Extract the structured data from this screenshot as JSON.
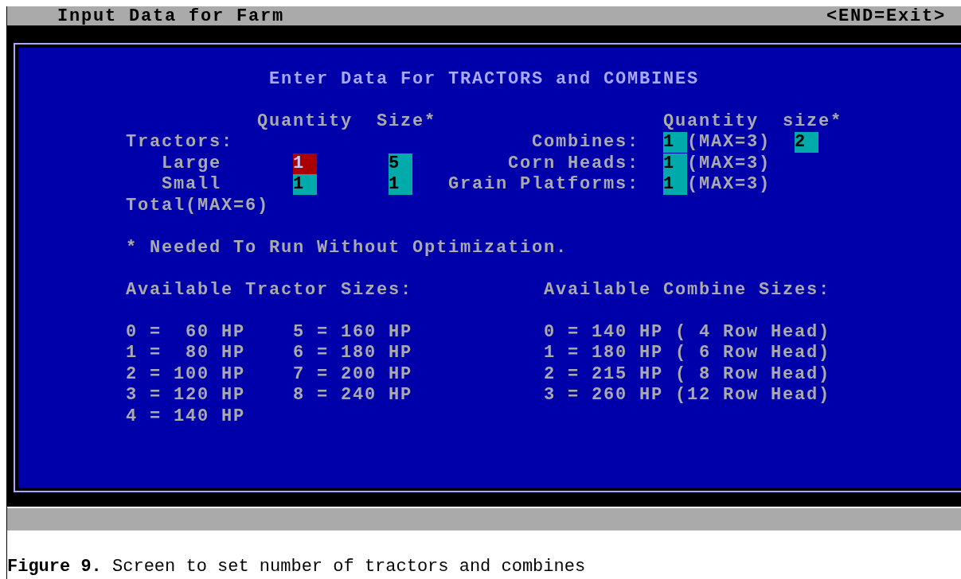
{
  "title_bar": {
    "title": "Input Data for Farm",
    "hint": "<END=Exit>"
  },
  "form": {
    "heading": "Enter Data For TRACTORS and COMBINES",
    "tractor_headers": [
      "Quantity",
      "Size*"
    ],
    "tractors_label": "Tractors:",
    "tractor_rows": [
      {
        "label": "Large",
        "quantity": {
          "value": "1",
          "selected": true
        },
        "size": {
          "value": "5",
          "selected": false
        }
      },
      {
        "label": "Small",
        "quantity": {
          "value": "1",
          "selected": false
        },
        "size": {
          "value": "1",
          "selected": false
        }
      }
    ],
    "total_label": "Total(MAX=6)",
    "combine_headers": [
      "Quantity",
      "size*"
    ],
    "combine_rows": [
      {
        "label": "Combines:",
        "quantity": {
          "value": "1",
          "selected": false
        },
        "max": "(MAX=3)",
        "size": {
          "value": "2",
          "selected": false
        }
      },
      {
        "label": "Corn Heads:",
        "quantity": {
          "value": "1",
          "selected": false
        },
        "max": "(MAX=3)"
      },
      {
        "label": "Grain Platforms:",
        "quantity": {
          "value": "1",
          "selected": false
        },
        "max": "(MAX=3)"
      }
    ],
    "note": "* Needed To Run Without Optimization.",
    "tractor_sizes_title": "Available Tractor Sizes:",
    "tractor_sizes": [
      "0 =  60 HP",
      "1 =  80 HP",
      "2 = 100 HP",
      "3 = 120 HP",
      "4 = 140 HP",
      "5 = 160 HP",
      "6 = 180 HP",
      "7 = 200 HP",
      "8 = 240 HP"
    ],
    "combine_sizes_title": "Available Combine Sizes:",
    "combine_sizes": [
      "0 = 140 HP ( 4 Row Head)",
      "1 = 180 HP ( 6 Row Head)",
      "2 = 215 HP ( 8 Row Head)",
      "3 = 260 HP (12 Row Head)"
    ]
  },
  "caption": {
    "label": "Figure 9.",
    "text": "Screen to set number of tractors and combines"
  }
}
